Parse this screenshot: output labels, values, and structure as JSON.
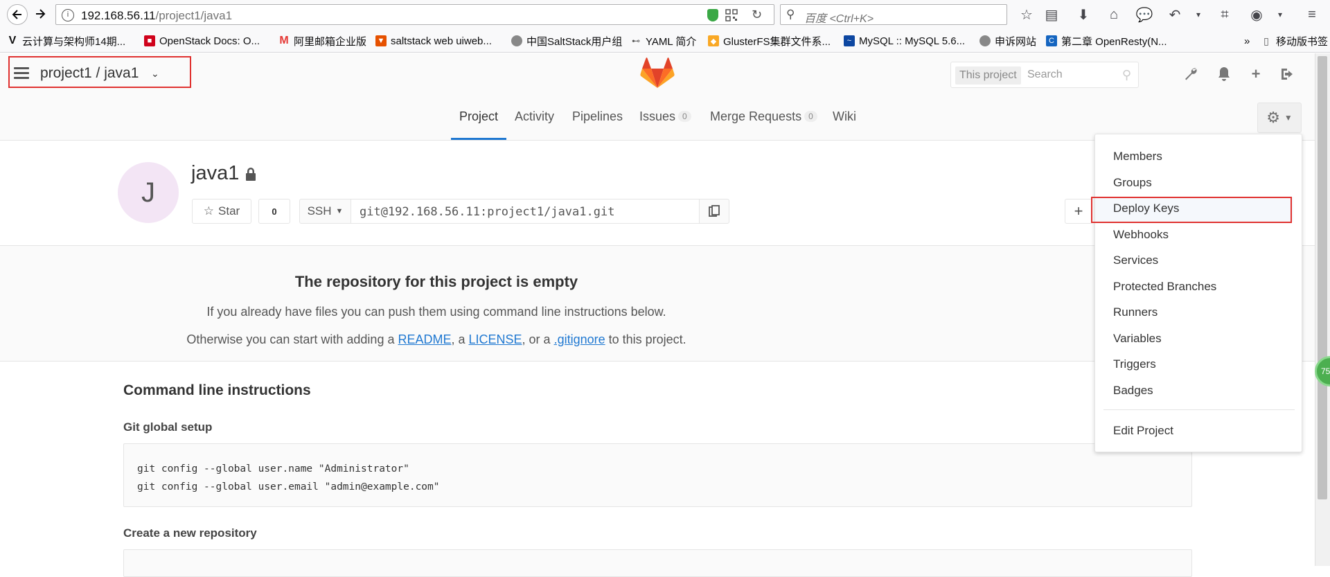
{
  "browser": {
    "url_host": "192.168.56.11",
    "url_path": "/project1/java1",
    "search_placeholder": "百度 <Ctrl+K>",
    "bookmarks": [
      {
        "label": "云计算与架构师14期...",
        "icon": "v-logo-icon"
      },
      {
        "label": "OpenStack Docs: O...",
        "icon": "openstack-icon"
      },
      {
        "label": "阿里邮箱企业版",
        "icon": "aliyun-mail-icon"
      },
      {
        "label": "saltstack web uiweb...",
        "icon": "saltstack-icon"
      },
      {
        "label": "中国SaltStack用户组",
        "icon": "globe-icon"
      },
      {
        "label": "YAML 简介",
        "icon": "yaml-icon"
      },
      {
        "label": "GlusterFS集群文件系...",
        "icon": "gluster-icon"
      },
      {
        "label": "MySQL :: MySQL 5.6...",
        "icon": "mysql-icon"
      },
      {
        "label": "申诉网站",
        "icon": "globe-icon"
      },
      {
        "label": "第二章 OpenResty(N...",
        "icon": "openresty-icon"
      }
    ],
    "mobile_bookmarks": "移动版书签",
    "overflow": "»"
  },
  "header": {
    "project_title": "project1 / java1",
    "search_scope": "This project",
    "search_placeholder": "Search"
  },
  "subnav": {
    "tabs": [
      {
        "label": "Project",
        "active": true
      },
      {
        "label": "Activity"
      },
      {
        "label": "Pipelines"
      },
      {
        "label": "Issues",
        "count": "0"
      },
      {
        "label": "Merge Requests",
        "count": "0"
      },
      {
        "label": "Wiki"
      }
    ]
  },
  "project": {
    "avatar_letter": "J",
    "name": "java1",
    "star_label": "Star",
    "star_count": "0",
    "protocol": "SSH",
    "clone_url": "git@192.168.56.11:project1/java1.git"
  },
  "empty": {
    "title": "The repository for this project is empty",
    "line1": "If you already have files you can push them using command line instructions below.",
    "line2_prefix": "Otherwise you can start with adding a ",
    "readme": "README",
    "sep1": ", a ",
    "license": "LICENSE",
    "sep2": ", or a ",
    "gitignore": ".gitignore",
    "line2_suffix": " to this project."
  },
  "cli": {
    "title": "Command line instructions",
    "git_setup_title": "Git global setup",
    "git_setup_lines": [
      "git config --global user.name \"Administrator\"",
      "git config --global user.email \"admin@example.com\""
    ],
    "create_repo_title": "Create a new repository"
  },
  "settings_menu": {
    "items": [
      "Members",
      "Groups",
      "Deploy Keys",
      "Webhooks",
      "Services",
      "Protected Branches",
      "Runners",
      "Variables",
      "Triggers",
      "Badges"
    ],
    "edit_project": "Edit Project",
    "highlighted": "Deploy Keys"
  },
  "perf_badge": "75",
  "colors": {
    "accent": "#1f78d1",
    "highlight_border": "#e0312f",
    "gitlab_orange": "#fc6d26"
  }
}
